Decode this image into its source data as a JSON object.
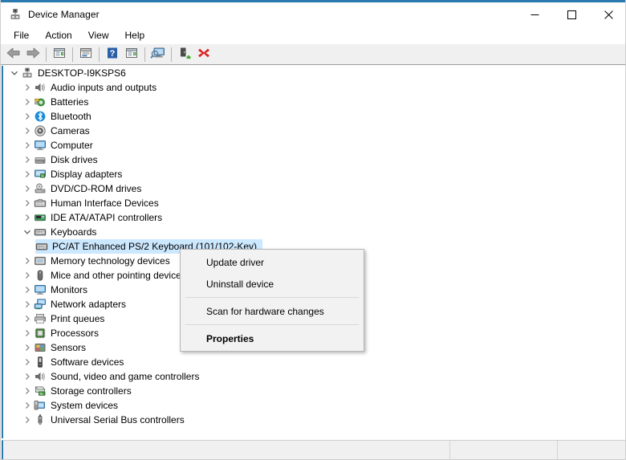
{
  "window": {
    "title": "Device Manager",
    "icon": "device-manager-icon",
    "accent_color": "#2a7ab0",
    "caption_buttons": [
      {
        "name": "minimize",
        "glyph": "—"
      },
      {
        "name": "maximize",
        "glyph": "□"
      },
      {
        "name": "close",
        "glyph": "✕"
      }
    ]
  },
  "menubar": {
    "items": [
      {
        "label": "File"
      },
      {
        "label": "Action"
      },
      {
        "label": "View"
      },
      {
        "label": "Help"
      }
    ]
  },
  "toolbar": {
    "buttons": [
      {
        "name": "back-button",
        "icon": "back-arrow-icon",
        "title": "Back"
      },
      {
        "name": "forward-button",
        "icon": "forward-arrow-icon",
        "title": "Forward"
      },
      {
        "name": "up-one-level-button",
        "icon": "console-tree-icon",
        "title": "Show/Hide console tree"
      },
      {
        "name": "properties-button",
        "icon": "properties-window-icon",
        "title": "Properties"
      },
      {
        "name": "help-button",
        "icon": "help-question-icon",
        "title": "Help"
      },
      {
        "name": "show-hide-tree-button",
        "icon": "play-window-icon",
        "title": "Show hidden devices"
      },
      {
        "name": "scan-hardware-button",
        "icon": "scan-monitor-icon",
        "title": "Scan for hardware changes"
      },
      {
        "name": "update-driver-button",
        "icon": "update-driver-icon",
        "title": "Update driver"
      },
      {
        "name": "uninstall-device-button",
        "icon": "red-x-icon",
        "title": "Uninstall device"
      }
    ]
  },
  "tree": {
    "root": {
      "label": "DESKTOP-I9KSPS6",
      "icon": "computer-root-icon",
      "expanded": true
    },
    "nodes": [
      {
        "label": "Audio inputs and outputs",
        "icon": "speaker-icon",
        "expanded": false,
        "indent": 1
      },
      {
        "label": "Batteries",
        "icon": "battery-icon",
        "expanded": false,
        "indent": 1
      },
      {
        "label": "Bluetooth",
        "icon": "bluetooth-icon",
        "expanded": false,
        "indent": 1
      },
      {
        "label": "Cameras",
        "icon": "camera-icon",
        "expanded": false,
        "indent": 1
      },
      {
        "label": "Computer",
        "icon": "monitor-icon",
        "expanded": false,
        "indent": 1
      },
      {
        "label": "Disk drives",
        "icon": "disk-drive-icon",
        "expanded": false,
        "indent": 1
      },
      {
        "label": "Display adapters",
        "icon": "display-adapter-icon",
        "expanded": false,
        "indent": 1
      },
      {
        "label": "DVD/CD-ROM drives",
        "icon": "dvd-drive-icon",
        "expanded": false,
        "indent": 1
      },
      {
        "label": "Human Interface Devices",
        "icon": "hid-icon",
        "expanded": false,
        "indent": 1
      },
      {
        "label": "IDE ATA/ATAPI controllers",
        "icon": "ide-controller-icon",
        "expanded": false,
        "indent": 1
      },
      {
        "label": "Keyboards",
        "icon": "keyboard-icon",
        "expanded": true,
        "indent": 1
      },
      {
        "label": "PC/AT Enhanced PS/2 Keyboard (101/102-Key)",
        "icon": "keyboard-icon",
        "leaf": true,
        "selected": true,
        "indent": 2
      },
      {
        "label": "Memory technology devices",
        "icon": "memory-icon",
        "expanded": false,
        "indent": 1
      },
      {
        "label": "Mice and other pointing devices",
        "icon": "mouse-icon",
        "expanded": false,
        "indent": 1
      },
      {
        "label": "Monitors",
        "icon": "monitor-icon",
        "expanded": false,
        "indent": 1
      },
      {
        "label": "Network adapters",
        "icon": "network-adapter-icon",
        "expanded": false,
        "indent": 1
      },
      {
        "label": "Print queues",
        "icon": "printer-icon",
        "expanded": false,
        "indent": 1
      },
      {
        "label": "Processors",
        "icon": "processor-icon",
        "expanded": false,
        "indent": 1
      },
      {
        "label": "Sensors",
        "icon": "sensor-icon",
        "expanded": false,
        "indent": 1
      },
      {
        "label": "Software devices",
        "icon": "software-device-icon",
        "expanded": false,
        "indent": 1
      },
      {
        "label": "Sound, video and game controllers",
        "icon": "speaker-icon",
        "expanded": false,
        "indent": 1
      },
      {
        "label": "Storage controllers",
        "icon": "storage-controller-icon",
        "expanded": false,
        "indent": 1
      },
      {
        "label": "System devices",
        "icon": "system-device-icon",
        "expanded": false,
        "indent": 1
      },
      {
        "label": "Universal Serial Bus controllers",
        "icon": "usb-icon",
        "expanded": false,
        "indent": 1
      }
    ]
  },
  "context_menu": {
    "visible": true,
    "items": [
      {
        "label": "Update driver",
        "bold": false,
        "name": "ctx-update-driver"
      },
      {
        "label": "Uninstall device",
        "bold": false,
        "name": "ctx-uninstall-device"
      },
      {
        "separator": true
      },
      {
        "label": "Scan for hardware changes",
        "bold": false,
        "name": "ctx-scan-hardware-changes"
      },
      {
        "separator": true
      },
      {
        "label": "Properties",
        "bold": true,
        "name": "ctx-properties"
      }
    ]
  },
  "statusbar": {
    "left": "",
    "middle": "",
    "right": ""
  },
  "colors": {
    "selection": "#cce8ff",
    "accent": "#2a7ab0",
    "toolbar_bg": "#f0f0f0",
    "menu_bg": "#f2f2f2"
  }
}
